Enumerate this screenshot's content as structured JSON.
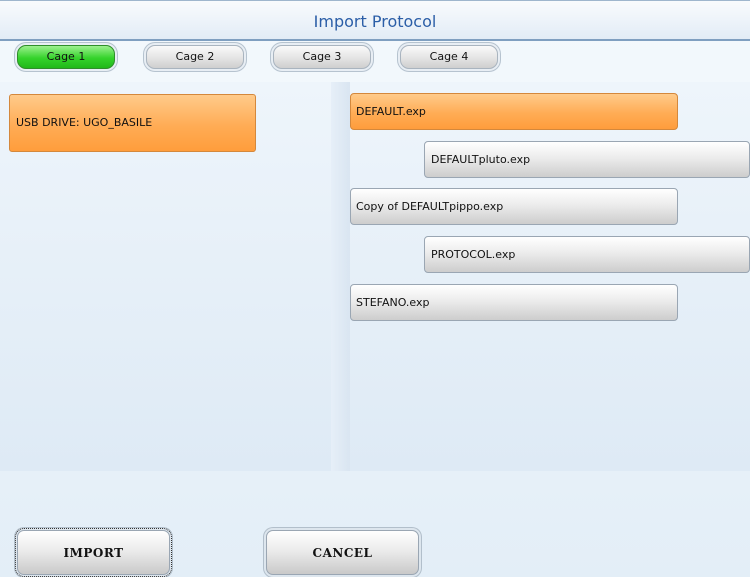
{
  "dialog": {
    "title": "Import Protocol"
  },
  "cages": [
    {
      "label": "Cage 1",
      "active": true
    },
    {
      "label": "Cage 2",
      "active": false
    },
    {
      "label": "Cage 3",
      "active": false
    },
    {
      "label": "Cage 4",
      "active": false
    }
  ],
  "drives": [
    {
      "label": "USB DRIVE: UGO_BASILE",
      "selected": true
    }
  ],
  "files": [
    {
      "name": "DEFAULT.exp",
      "selected": true
    },
    {
      "name": "DEFAULTpluto.exp",
      "selected": false
    },
    {
      "name": "Copy of DEFAULTpippo.exp",
      "selected": false
    },
    {
      "name": "PROTOCOL.exp",
      "selected": false
    },
    {
      "name": "STEFANO.exp",
      "selected": false
    }
  ],
  "buttons": {
    "import": "IMPORT",
    "cancel": "CANCEL"
  },
  "colors": {
    "title_text": "#2b5ea7",
    "active_cage": "#35d32b",
    "selected_item": "#ffac55",
    "background": "#e3eef7"
  }
}
